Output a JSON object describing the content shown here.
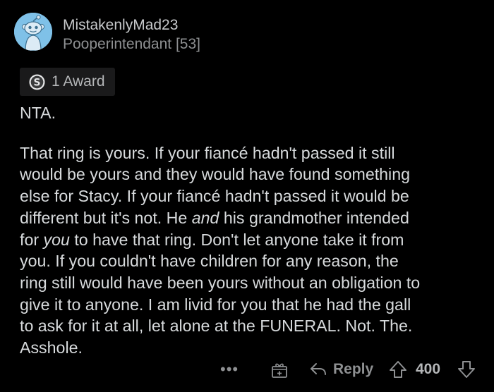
{
  "comment": {
    "username": "MistakenlyMad23",
    "flair": "Pooperintendant [53]",
    "award_label": "1 Award",
    "body": {
      "p1": "NTA.",
      "p2": [
        "That ring is yours. If your fiancé hadn't passed it still",
        "would be yours and they would have found something",
        "else for Stacy. If your fiancé hadn't passed it would be",
        [
          "different but it's not. He ",
          "and",
          " his grandmother intended"
        ],
        [
          "for ",
          "you",
          " to have that ring. Don't let anyone take it from"
        ],
        "you. If you couldn't have children for any reason, the",
        "ring still would have been yours without an obligation to",
        "give it to anyone. I am livid for you that he had the gall",
        "to ask for it at all, let alone at the FUNERAL. Not. The.",
        "Asshole."
      ]
    }
  },
  "actions": {
    "more": "•••",
    "reply_label": "Reply",
    "score": "400"
  },
  "icons": {
    "avatar": "reddit-snoo-avatar",
    "award": "silver-award-icon",
    "more": "more-options-icon",
    "gift": "give-award-icon",
    "reply": "reply-arrow-icon",
    "upvote": "upvote-arrow-icon",
    "downvote": "downvote-arrow-icon"
  },
  "colors": {
    "background": "#000000",
    "text": "#d7dadc",
    "muted": "#8e9092",
    "avatar_bg": "#7fc1e8",
    "award_bg": "#1a1a1b"
  }
}
